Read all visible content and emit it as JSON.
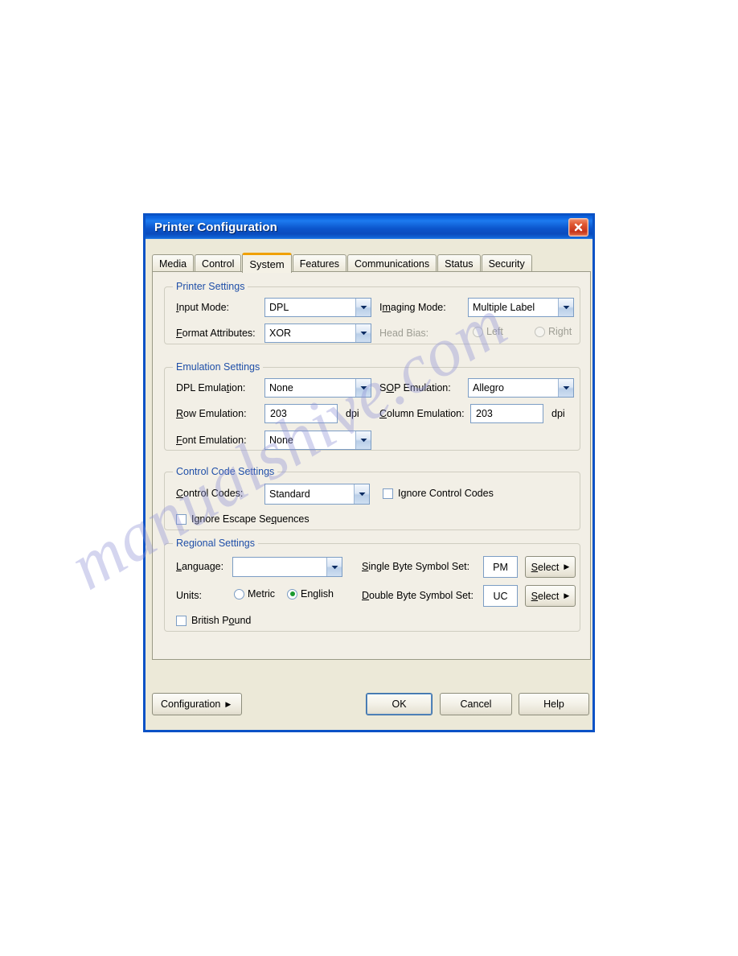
{
  "window": {
    "title": "Printer Configuration",
    "close_icon": "close-x-icon",
    "accent_titlebar": "#0b55cc",
    "accent_tab_active": "#f0a000",
    "accent_group_title": "#1f4fa8"
  },
  "watermark": {
    "text": "manualshive.com",
    "color": "#8f93d6"
  },
  "tabs": [
    {
      "label": "Media",
      "active": false
    },
    {
      "label": "Control",
      "active": false
    },
    {
      "label": "System",
      "active": true
    },
    {
      "label": "Features",
      "active": false
    },
    {
      "label": "Communications",
      "active": false
    },
    {
      "label": "Status",
      "active": false
    },
    {
      "label": "Security",
      "active": false
    }
  ],
  "printer_settings": {
    "title": "Printer Settings",
    "input_mode_label": "Input Mode:",
    "input_mode_value": "DPL",
    "format_attributes_label": "Format Attributes:",
    "format_attributes_value": "XOR",
    "imaging_mode_label": "Imaging Mode:",
    "imaging_mode_value": "Multiple Label",
    "head_bias_label": "Head Bias:",
    "head_bias_left": "Left",
    "head_bias_right": "Right",
    "head_bias_selected": "",
    "head_bias_disabled": true
  },
  "emulation_settings": {
    "title": "Emulation Settings",
    "dpl_emulation_label": "DPL Emulation:",
    "dpl_emulation_value": "None",
    "row_emulation_label": "Row Emulation:",
    "row_emulation_value": "203",
    "row_emulation_units": "dpi",
    "font_emulation_label": "Font Emulation:",
    "font_emulation_value": "None",
    "sop_emulation_label": "SOP Emulation:",
    "sop_emulation_value": "Allegro",
    "column_emulation_label": "Column Emulation:",
    "column_emulation_value": "203",
    "column_emulation_units": "dpi"
  },
  "control_code_settings": {
    "title": "Control Code Settings",
    "control_codes_label": "Control Codes:",
    "control_codes_value": "Standard",
    "ignore_control_codes_label": "Ignore Control Codes",
    "ignore_control_codes_checked": false,
    "ignore_escape_sequences_label": "Ignore Escape Sequences",
    "ignore_escape_sequences_checked": false
  },
  "regional_settings": {
    "title": "Regional Settings",
    "language_label": "Language:",
    "language_value": "",
    "units_label": "Units:",
    "units_metric": "Metric",
    "units_english": "English",
    "units_selected": "English",
    "british_pound_label": "British Pound",
    "british_pound_checked": false,
    "single_byte_label": "Single Byte Symbol Set:",
    "single_byte_value": "PM",
    "single_byte_button": "Select",
    "double_byte_label": "Double Byte Symbol Set:",
    "double_byte_value": "UC",
    "double_byte_button": "Select"
  },
  "footer": {
    "configuration_label": "Configuration",
    "ok_label": "OK",
    "cancel_label": "Cancel",
    "help_label": "Help"
  }
}
